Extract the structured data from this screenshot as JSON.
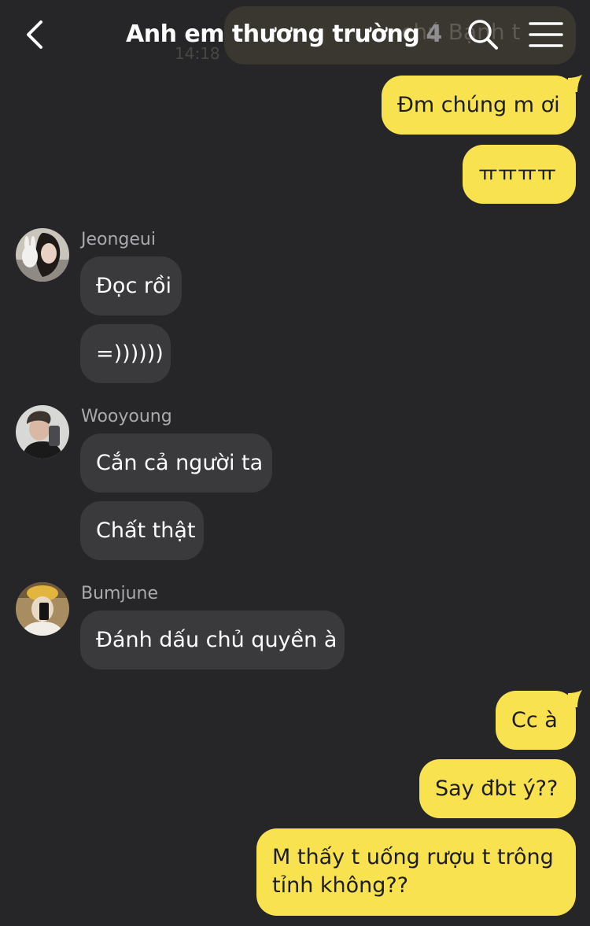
{
  "header": {
    "title": "Anh em thương trường",
    "member_count": "4"
  },
  "pinned_preview": {
    "text": "chú Bạnh t",
    "time": "14:18"
  },
  "messages": {
    "m1": "Đm chúng m ơi",
    "m2": "ㅠㅠㅠㅠ",
    "m3_sender": "Jeongeui",
    "m3": "Đọc rồi",
    "m4": "=))))))",
    "m5_sender": "Wooyoung",
    "m5": "Cắn cả người ta",
    "m6": "Chất thật",
    "m7_sender": "Bumjune",
    "m7": "Đánh dấu chủ quyền à",
    "m8": "Cc à",
    "m9": "Say đbt ý??",
    "m10": "M thấy t uống rượu t trông tỉnh không??"
  },
  "colors": {
    "background": "#262629",
    "outgoing_bubble": "#f9e24f",
    "incoming_bubble": "#3a3a3d",
    "sender_name": "#a9a9ae"
  },
  "icons": {
    "back": "chevron-left-icon",
    "search": "search-icon",
    "menu": "hamburger-menu-icon"
  }
}
